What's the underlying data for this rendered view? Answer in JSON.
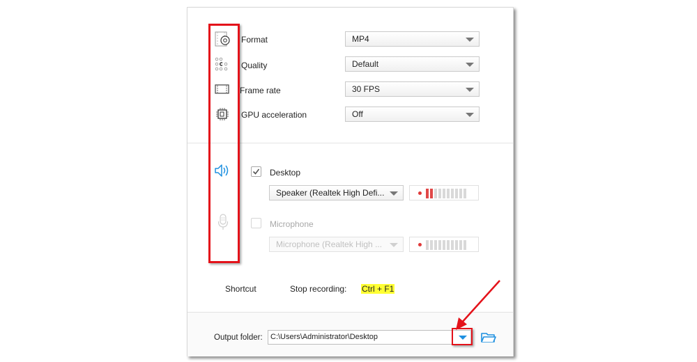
{
  "settings": {
    "format": {
      "label": "Format",
      "value": "MP4",
      "icon": "format-gear-icon"
    },
    "quality": {
      "label": "Quality",
      "value": "Default",
      "icon": "quality-dots-icon"
    },
    "frame_rate": {
      "label": "Frame rate",
      "value": "30 FPS",
      "icon": "frame-rate-icon"
    },
    "gpu": {
      "label": "GPU acceleration",
      "value": "Off",
      "icon": "gpu-chip-icon"
    }
  },
  "audio": {
    "desktop": {
      "label": "Desktop",
      "checked": true,
      "device": "Speaker (Realtek High Defi...",
      "level_segments_on": 2,
      "level_segments_total": 10,
      "icon": "speaker-icon"
    },
    "microphone": {
      "label": "Microphone",
      "checked": false,
      "disabled": true,
      "device": "Microphone (Realtek High ...",
      "level_segments_on": 0,
      "level_segments_total": 10,
      "icon": "microphone-icon"
    }
  },
  "shortcut": {
    "label": "Shortcut",
    "action": "Stop recording:",
    "keys": "Ctrl + F1"
  },
  "output": {
    "label": "Output folder:",
    "path": "C:\\Users\\Administrator\\Desktop",
    "dropdown_icon": "chevron-down-icon",
    "folder_icon": "folder-open-icon"
  },
  "colors": {
    "annotation": "#e4121a",
    "accent_blue": "#1e90e0",
    "highlight": "#ffff33",
    "meter_active": "#e04848"
  }
}
